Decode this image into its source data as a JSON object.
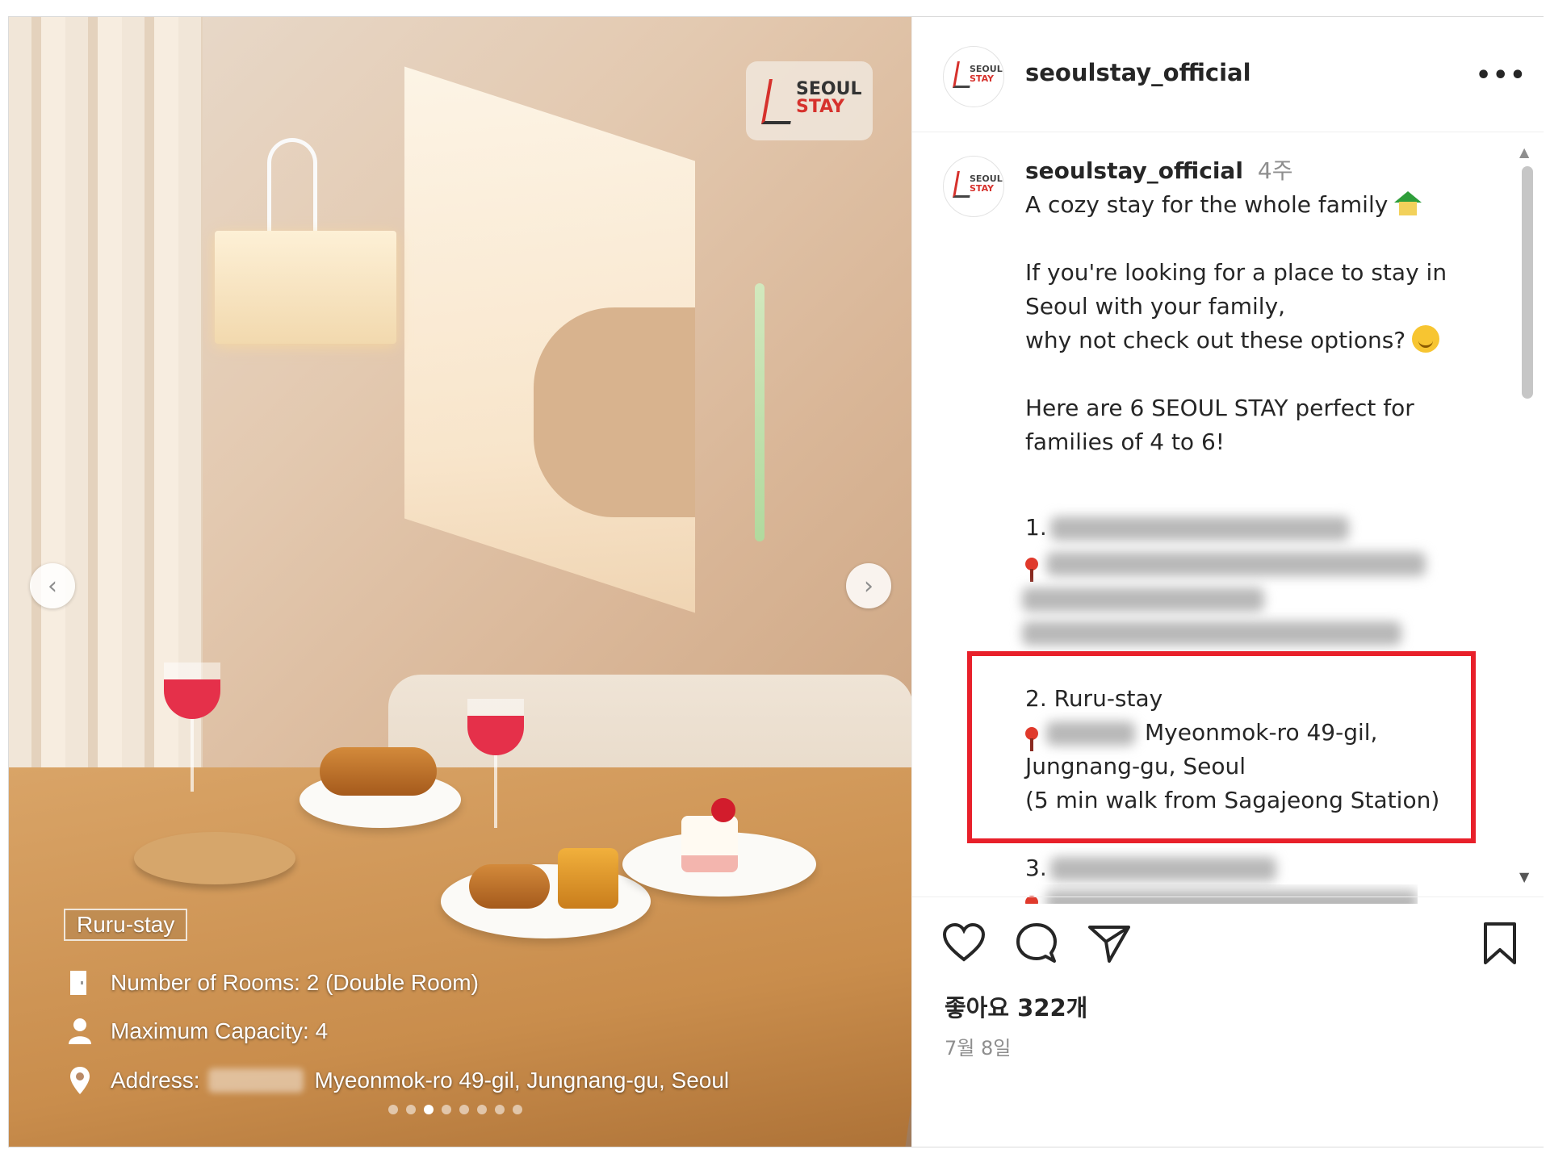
{
  "post": {
    "username": "seoulstay_official",
    "more_label": "•••",
    "logo_text": [
      "SEOUL",
      "STAY"
    ]
  },
  "photo": {
    "overlay": {
      "name": "Ruru-stay",
      "rooms": "Number of Rooms: 2 (Double Room)",
      "capacity": "Maximum Capacity: 4",
      "address_label": "Address:",
      "address_value": "Myeonmok-ro 49-gil, Jungnang-gu, Seoul"
    },
    "nav": {
      "prev": "‹",
      "next": "›"
    },
    "carousel": {
      "total": 8,
      "active_index": 2
    }
  },
  "caption": {
    "username": "seoulstay_official",
    "time": "4주",
    "line1": "A cozy stay for the whole family",
    "p2_line1": "If you're looking for a place to stay in",
    "p2_line2": "Seoul with your family,",
    "p2_line3": "why not check out these options?",
    "p3_line1": "Here are 6 SEOUL STAY perfect for",
    "p3_line2": "families of 4 to 6!",
    "item1_num": "1.",
    "item2_title": "2. Ruru-stay",
    "item2_addr1": "Myeonmok-ro 49-gil,",
    "item2_addr2": "Jungnang-gu, Seoul",
    "item2_walk": "(5 min walk from Sagajeong Station)",
    "item3_num": "3."
  },
  "actions": {
    "icons": [
      "heart-icon",
      "comment-icon",
      "share-icon",
      "bookmark-icon"
    ]
  },
  "likes": "좋아요 322개",
  "date": "7월 8일",
  "colors": {
    "highlight": "#e8202a",
    "text": "#262626",
    "muted": "#8e8e8e"
  }
}
